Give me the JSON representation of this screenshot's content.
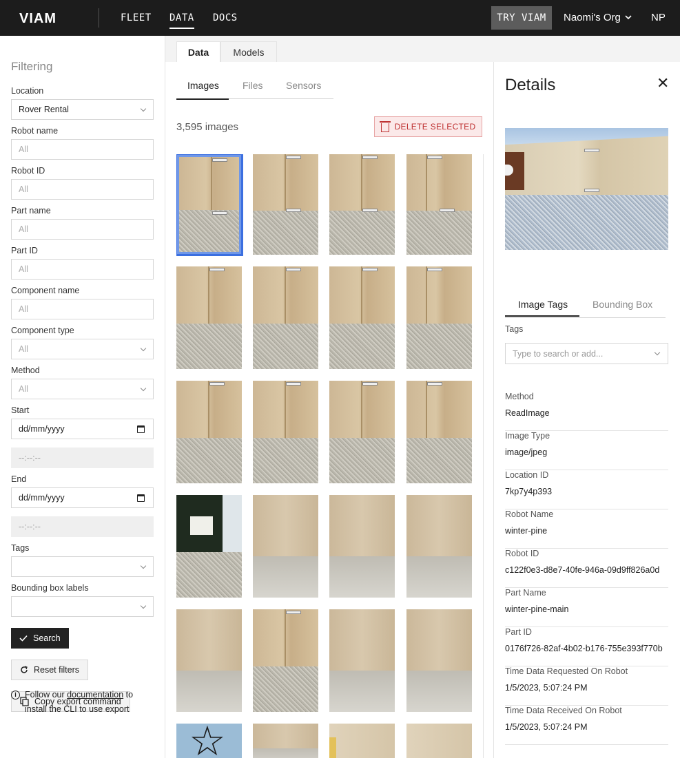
{
  "header": {
    "logo": "VIAM",
    "nav": [
      "FLEET",
      "DATA",
      "DOCS"
    ],
    "active_nav": "DATA",
    "try_button": "TRY VIAM",
    "org_name": "Naomi's Org",
    "avatar_initials": "NP"
  },
  "filters": {
    "title": "Filtering",
    "location_label": "Location",
    "location_value": "Rover Rental",
    "robot_name_label": "Robot name",
    "robot_name_placeholder": "All",
    "robot_id_label": "Robot ID",
    "robot_id_placeholder": "All",
    "part_name_label": "Part name",
    "part_name_placeholder": "All",
    "part_id_label": "Part ID",
    "part_id_placeholder": "All",
    "component_name_label": "Component name",
    "component_name_placeholder": "All",
    "component_type_label": "Component type",
    "component_type_value": "All",
    "method_label": "Method",
    "method_value": "All",
    "start_label": "Start",
    "start_date": "dd/mm/yyyy",
    "start_time": "--:--:--",
    "end_label": "End",
    "end_date": "dd/mm/yyyy",
    "end_time": "--:--:--",
    "tags_label": "Tags",
    "bbox_label": "Bounding box labels",
    "search_button": "Search",
    "reset_button": "Reset filters",
    "copy_button": "Copy export command",
    "info_prefix": "Follow our ",
    "info_link": "documentation",
    "info_suffix": " to install the CLI to use export"
  },
  "main_tabs": [
    "Data",
    "Models"
  ],
  "active_main_tab": "Data",
  "sub_tabs": [
    "Images",
    "Files",
    "Sensors"
  ],
  "active_sub_tab": "Images",
  "image_count": "3,595 images",
  "delete_button": "DELETE SELECTED",
  "details": {
    "title": "Details",
    "tabs": [
      "Image Tags",
      "Bounding Box"
    ],
    "tags_label": "Tags",
    "tags_placeholder": "Type to search or add...",
    "fields": [
      {
        "label": "Method",
        "value": "ReadImage"
      },
      {
        "label": "Image Type",
        "value": "image/jpeg"
      },
      {
        "label": "Location ID",
        "value": "7kp7y4p393"
      },
      {
        "label": "Robot Name",
        "value": "winter-pine"
      },
      {
        "label": "Robot ID",
        "value": "c122f0e3-d8e7-40fe-946a-09d9ff826a0d"
      },
      {
        "label": "Part Name",
        "value": "winter-pine-main"
      },
      {
        "label": "Part ID",
        "value": "0176f726-82af-4b02-b176-755e393f770b"
      },
      {
        "label": "Time Data Requested On Robot",
        "value": "1/5/2023, 5:07:24 PM"
      },
      {
        "label": "Time Data Received On Robot",
        "value": "1/5/2023, 5:07:24 PM"
      }
    ]
  },
  "colors": {
    "topbar": "#1c1c1c",
    "selected_border": "#3b6fe0",
    "delete_text": "#be3030",
    "delete_bg": "#fbe9e9"
  }
}
